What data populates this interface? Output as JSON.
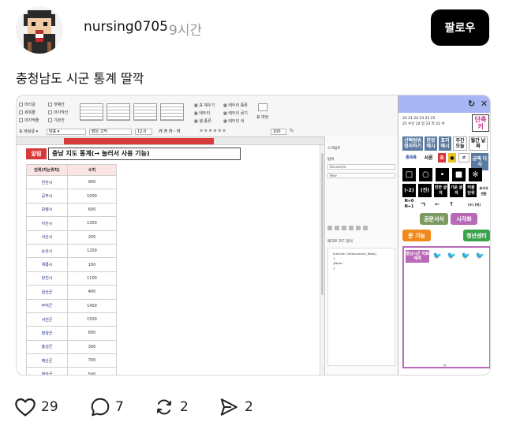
{
  "post": {
    "username": "nursing0705",
    "time": "9시간",
    "follow_label": "팔로우",
    "text": "충청남도 시군 통계 딸깍"
  },
  "actions": {
    "likes": "29",
    "comments": "7",
    "reposts": "2",
    "shares": "2"
  },
  "screenshot": {
    "ribbon": {
      "font_name": "맑은 고딕",
      "font_size": "12.0",
      "zoom": "100",
      "zoom_unit": "%"
    },
    "doc": {
      "warn_label": "알림",
      "title": "충남 지도 통계(→ 눌러서 사용 기능)",
      "table_headers": [
        "단위(지는위치)",
        "수치"
      ],
      "rows": [
        [
          "천안시",
          "900"
        ],
        [
          "공주시",
          "1000"
        ],
        [
          "보령시",
          "600"
        ],
        [
          "아산시",
          "1300"
        ],
        [
          "서산시",
          "200"
        ],
        [
          "논산시",
          "1200"
        ],
        [
          "계룡시",
          "100"
        ],
        [
          "당진시",
          "1100"
        ],
        [
          "금산군",
          "400"
        ],
        [
          "부여군",
          "1400"
        ],
        [
          "서천군",
          "1500"
        ],
        [
          "청양군",
          "800"
        ],
        [
          "홍성군",
          "300"
        ],
        [
          "예산군",
          "700"
        ],
        [
          "태안군",
          "500"
        ]
      ]
    },
    "script": {
      "title": "스크립트",
      "section1": "범위",
      "box1": "Document",
      "box2": "New",
      "section2": "매크로 코드 정의",
      "code": [
        "function OnDocument_New()",
        "{",
        "  //Note:",
        "}"
      ]
    },
    "tool": {
      "cal_numbers": "20 21 24 23 22 25",
      "cal_week": "25 수신 24 일 23 목 22 수",
      "btn_select": "선택범위 정리하기",
      "btn_table_ex": "한장 예시",
      "btn_mark_ex": "표지 예시",
      "btn_week": "주간 오늘",
      "btn_month": "월간 날짜",
      "btn_shortcut": "단축 키",
      "label_format": "종목록",
      "label_table": "서론",
      "btn_pyo": "표",
      "btn_report": "금액 다시",
      "sym1": "(-2)",
      "sym2": "(진)",
      "btn_jinhan": "진한 글자",
      "btn_gigu": "기운 글자",
      "btn_eoul": "어울 단위",
      "btn_pyosisa": "표식식 변환",
      "sym_n": "N+0 N+1",
      "sym_kk": "ㄱ",
      "btn_formal": "공문서식",
      "btn_visual": "시각화",
      "btn_etc": "문 기능",
      "btn_youth": "청년센터",
      "btn_region": "충남시군 자료에게",
      "btn_gy": "동",
      "btn_mode": "금액 다시"
    },
    "colors": {
      "accent_blue": "#a8b6f5",
      "purple": "#b86ab9",
      "red": "#d93838",
      "green": "#3aa24a",
      "orange": "#f08a1c",
      "olive": "#7b9b61",
      "steel": "#5a7aa0"
    }
  }
}
